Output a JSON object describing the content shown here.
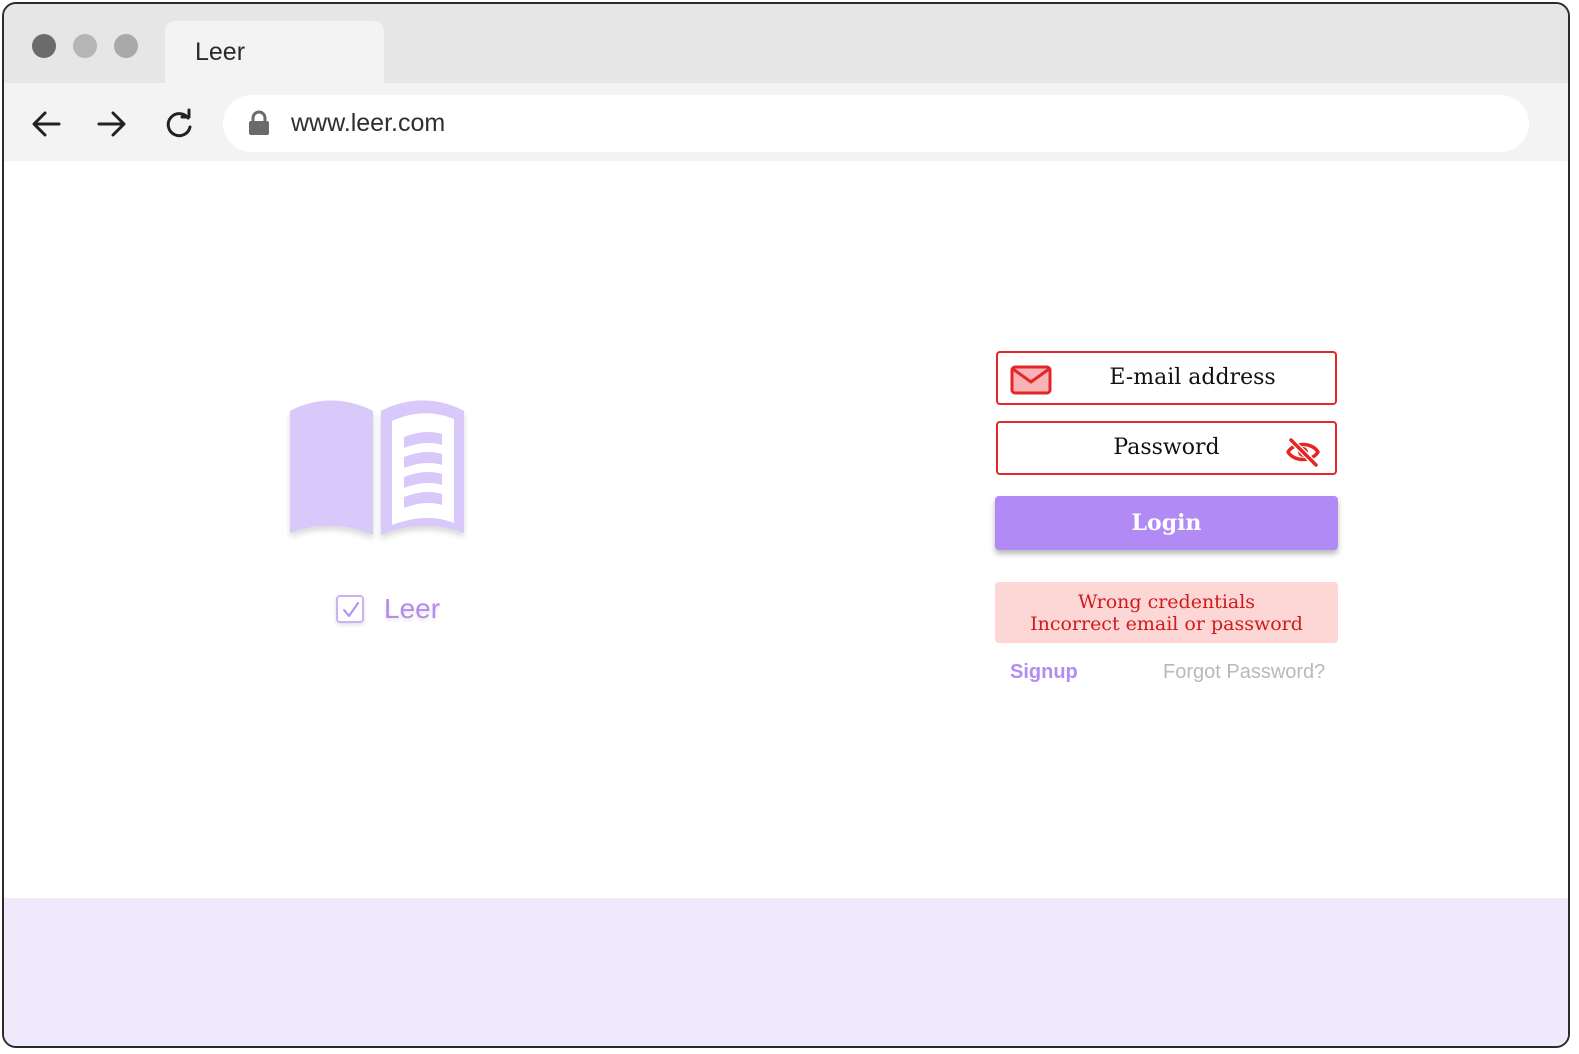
{
  "browser": {
    "tab_title": "Leer",
    "url": "www.leer.com"
  },
  "brand": {
    "name": "Leer",
    "icon": "open-book-icon",
    "accent_color": "#b48cf1"
  },
  "login_form": {
    "email_label": "E-mail address",
    "password_label": "Password",
    "login_label": "Login",
    "error_title": "Wrong credentials",
    "error_message": "Incorrect email or password",
    "signup_label": "Signup",
    "forgot_label": "Forgot Password?",
    "error_color": "#e32626",
    "button_color": "#b28af5"
  }
}
